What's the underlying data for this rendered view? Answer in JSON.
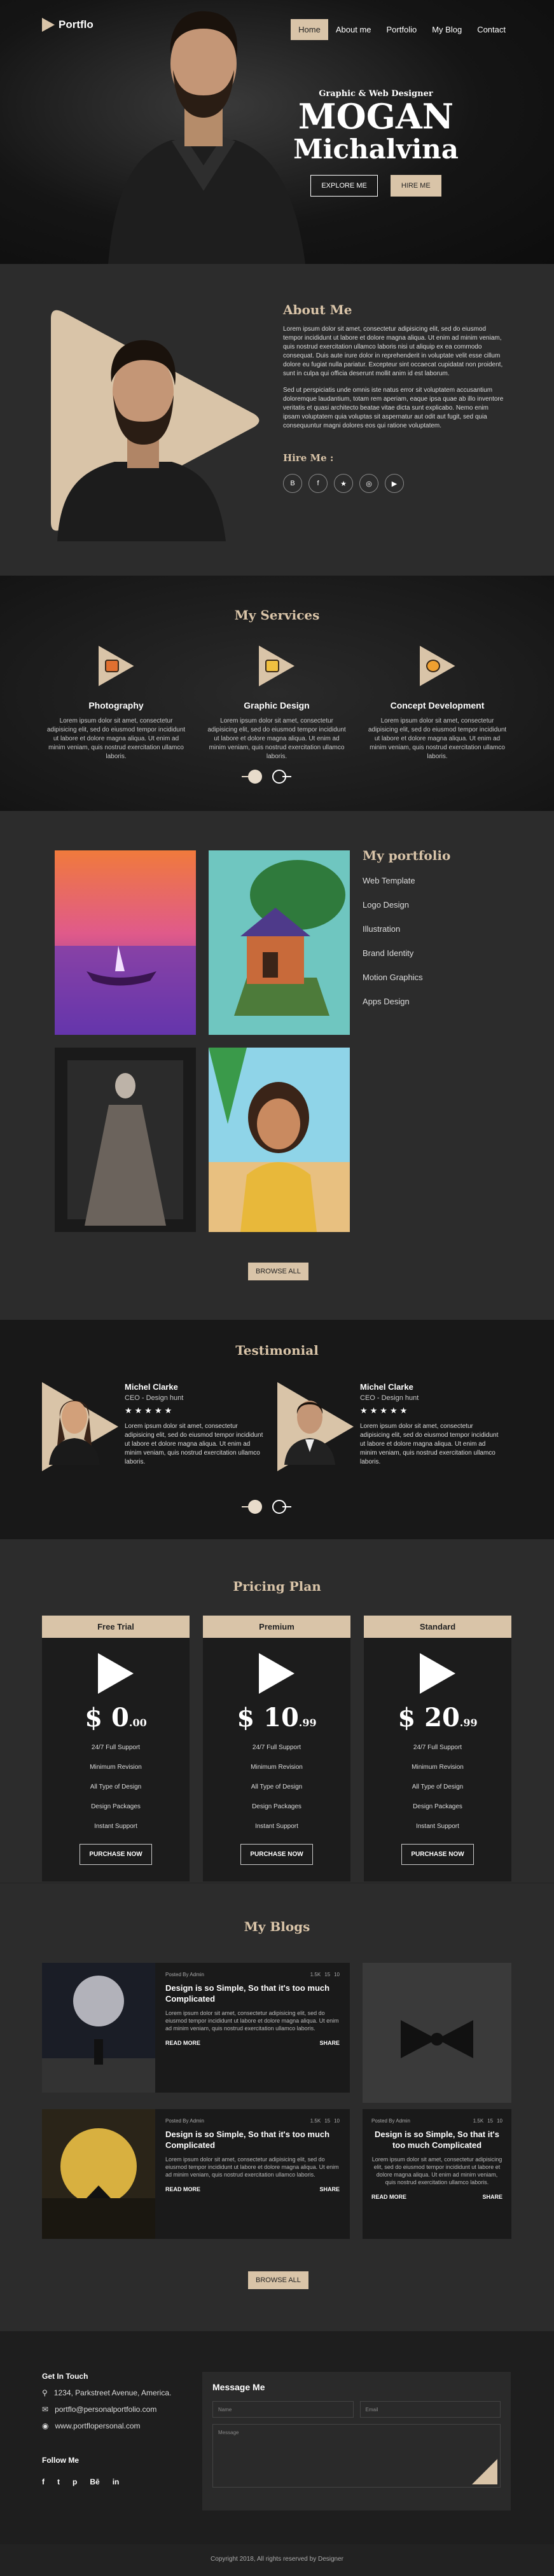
{
  "colors": {
    "accent": "#d9c4a8",
    "dark": "#141414",
    "panel": "#2c2c2c"
  },
  "brand": {
    "name": "Portflo"
  },
  "nav": [
    "Home",
    "About me",
    "Portfolio",
    "My Blog",
    "Contact"
  ],
  "hero": {
    "subtitle": "Graphic & Web Designer",
    "first_name": "MOGAN",
    "last_name": "Michalvina",
    "explore_label": "EXPLORE ME",
    "hire_label": "HIRE ME"
  },
  "about": {
    "title": "About Me",
    "p1": "Lorem ipsum dolor sit amet, consectetur adipisicing elit, sed do eiusmod tempor incididunt ut labore et dolore magna aliqua. Ut enim ad minim veniam, quis nostrud exercitation ullamco laboris nisi ut aliquip ex ea commodo consequat. Duis aute irure dolor in reprehenderit in voluptate velit esse cillum dolore eu fugiat nulla pariatur. Excepteur sint occaecat cupidatat non proident, sunt in culpa qui officia deserunt mollit anim id est laborum.",
    "p2": "Sed ut perspiciatis unde omnis iste natus error sit voluptatem accusantium doloremque laudantium, totam rem aperiam, eaque ipsa quae ab illo inventore veritatis et quasi architecto beatae vitae dicta sunt explicabo. Nemo enim ipsam voluptatem quia voluptas sit aspernatur aut odit aut fugit, sed quia consequuntur magni dolores eos qui ratione voluptatem.",
    "hire_title": "Hire Me :",
    "socials": [
      "B",
      "f",
      "★",
      "◎",
      "▶"
    ]
  },
  "services": {
    "title": "My Services",
    "items": [
      {
        "name": "Photography",
        "text": "Lorem ipsum dolor sit amet, consectetur adipisicing elit, sed do eiusmod tempor incididunt ut labore et dolore magna aliqua. Ut enim ad minim veniam, quis nostrud exercitation ullamco laboris."
      },
      {
        "name": "Graphic Design",
        "text": "Lorem ipsum dolor sit amet, consectetur adipisicing elit, sed do eiusmod tempor incididunt ut labore et dolore magna aliqua. Ut enim ad minim veniam, quis nostrud exercitation ullamco laboris."
      },
      {
        "name": "Concept Development",
        "text": "Lorem ipsum dolor sit amet, consectetur adipisicing elit, sed do eiusmod tempor incididunt ut labore et dolore magna aliqua. Ut enim ad minim veniam, quis nostrud exercitation ullamco laboris."
      }
    ]
  },
  "portfolio": {
    "title": "My portfolio",
    "items": [
      "Web Template",
      "Logo Design",
      "Illustration",
      "Brand Identity",
      "Motion Graphics",
      "Apps Design"
    ],
    "browse_label": "BROWSE ALL"
  },
  "testimonial": {
    "title": "Testimonial",
    "items": [
      {
        "name": "Michel Clarke",
        "role": "CEO - Design hunt",
        "stars": "★★★★★",
        "text": "Lorem ipsum dolor sit amet, consectetur adipisicing elit, sed do eiusmod tempor incididunt ut labore et dolore magna aliqua. Ut enim ad minim veniam, quis nostrud exercitation ullamco laboris."
      },
      {
        "name": "Michel Clarke",
        "role": "CEO - Design hunt",
        "stars": "★★★★★",
        "text": "Lorem ipsum dolor sit amet, consectetur adipisicing elit, sed do eiusmod tempor incididunt ut labore et dolore magna aliqua. Ut enim ad minim veniam, quis nostrud exercitation ullamco laboris."
      }
    ]
  },
  "pricing": {
    "title": "Pricing Plan",
    "features": [
      "24/7 Full Support",
      "Minimum Revision",
      "All Type of Design",
      "Design Packages",
      "Instant Support"
    ],
    "buy_label": "PURCHASE NOW",
    "plans": [
      {
        "name": "Free Trial",
        "dollar": "$",
        "amount": "0",
        "cents": ".00"
      },
      {
        "name": "Premium",
        "dollar": "$",
        "amount": "10",
        "cents": ".99"
      },
      {
        "name": "Standard",
        "dollar": "$",
        "amount": "20",
        "cents": ".99"
      }
    ]
  },
  "blogs": {
    "title": "My Blogs",
    "meta_author": "Posted By Admin",
    "meta_likes": "1.5K",
    "meta_views": "15",
    "meta_comments": "10",
    "meta_likes_alt": "1.5K",
    "post_title": "Design is so Simple, So that it's too much Complicated",
    "post_text": "Lorem ipsum dolor sit amet, consectetur adipisicing elit, sed do eiusmod tempor incididunt ut labore et dolore magna aliqua. Ut enim ad minim veniam, quis nostrud exercitation ullamco laboris.",
    "read_more": "READ MORE",
    "share": "SHARE",
    "browse_label": "BROWSE ALL"
  },
  "contact": {
    "title": "Get In Touch",
    "address": "1234, Parkstreet Avenue, America.",
    "email": "portflo@personalportfolio.com",
    "web": "www.portflopersonal.com",
    "follow": "Follow Me",
    "follow_icons": [
      "f",
      "t",
      "p",
      "Bē",
      "in"
    ],
    "message_title": "Message Me",
    "name_ph": "Name",
    "email_ph": "Email",
    "message_ph": "Message"
  },
  "copyright": "Copyright 2018, All rights reserved by Designer"
}
